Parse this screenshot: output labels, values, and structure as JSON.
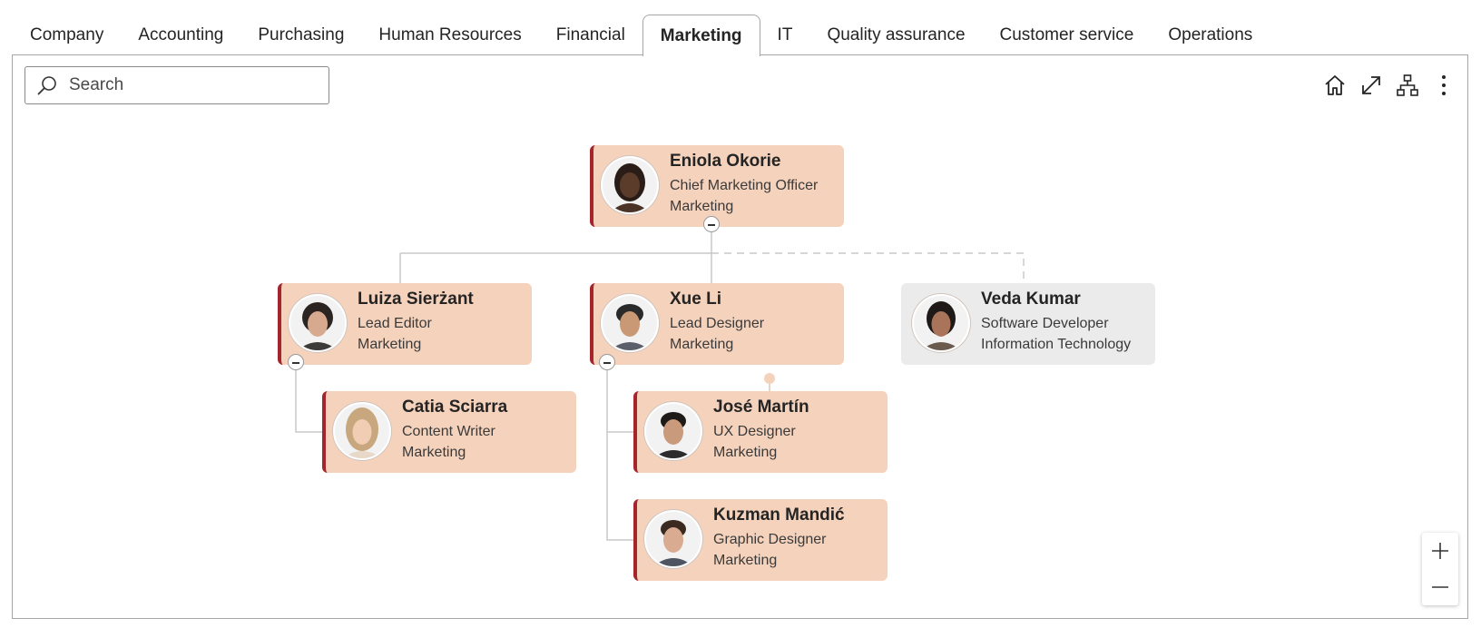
{
  "tabs": [
    {
      "label": "Company"
    },
    {
      "label": "Accounting"
    },
    {
      "label": "Purchasing"
    },
    {
      "label": "Human Resources"
    },
    {
      "label": "Financial"
    },
    {
      "label": "Marketing",
      "active": true
    },
    {
      "label": "IT"
    },
    {
      "label": "Quality assurance"
    },
    {
      "label": "Customer service"
    },
    {
      "label": "Operations"
    }
  ],
  "search": {
    "placeholder": "Search",
    "value": "",
    "icon": "search-icon"
  },
  "toolbar": {
    "icons": [
      "home-icon",
      "expand-icon",
      "org-chart-icon",
      "more-vertical-icon"
    ]
  },
  "colors": {
    "node_bg": "#f5d2bc",
    "node_accent": "#a4262c",
    "other_node_bg": "#ebebeb",
    "connector": "#c8c8c8"
  },
  "nodes": {
    "eniola": {
      "name": "Eniola Okorie",
      "title": "Chief Marketing Officer",
      "department": "Marketing"
    },
    "luiza": {
      "name": "Luiza Sierżant",
      "title": "Lead Editor",
      "department": "Marketing"
    },
    "xue": {
      "name": "Xue Li",
      "title": "Lead Designer",
      "department": "Marketing"
    },
    "veda": {
      "name": "Veda Kumar",
      "title": "Software Developer",
      "department": "Information Technology"
    },
    "catia": {
      "name": "Catia Sciarra",
      "title": "Content Writer",
      "department": "Marketing"
    },
    "jose": {
      "name": "José Martín",
      "title": "UX Designer",
      "department": "Marketing"
    },
    "kuzman": {
      "name": "Kuzman Mandić",
      "title": "Graphic Designer",
      "department": "Marketing"
    }
  },
  "zoom": {
    "in_icon": "plus-icon",
    "out_icon": "minus-icon"
  }
}
